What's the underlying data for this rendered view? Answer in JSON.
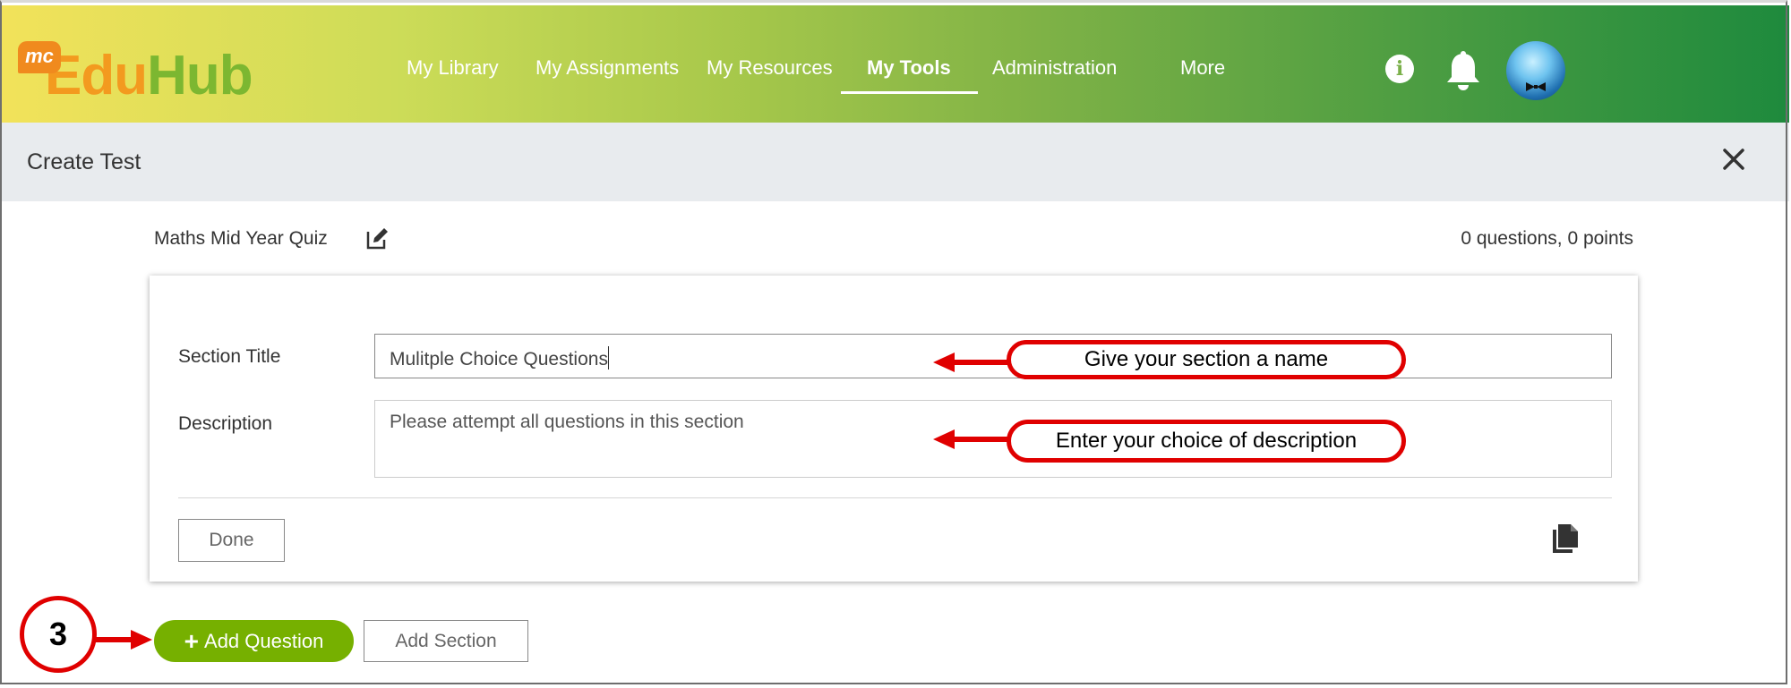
{
  "logo": {
    "badge": "mc",
    "part1": "Edu",
    "part2": "Hub"
  },
  "nav": {
    "items": [
      "My Library",
      "My Assignments",
      "My Resources",
      "My Tools",
      "Administration",
      "More"
    ],
    "active": "My Tools"
  },
  "header": {
    "title": "Create Test",
    "close_icon": "close-icon"
  },
  "test": {
    "name": "Maths Mid Year Quiz",
    "counts": "0 questions, 0 points"
  },
  "section": {
    "title_label": "Section Title",
    "title_value": "Mulitple Choice Questions",
    "description_label": "Description",
    "description_value": "Please attempt all questions in this section",
    "done_label": "Done"
  },
  "actions": {
    "add_question": "Add Question",
    "add_section": "Add Section"
  },
  "annotations": {
    "callout_title": "Give your section a name",
    "callout_description": "Enter your choice of description",
    "step_number": "3"
  },
  "colors": {
    "accent_green": "#76b000",
    "annotation_red": "#e00000",
    "header_gray": "#e8ebee"
  },
  "icons": [
    "info-icon",
    "bell-icon",
    "avatar",
    "close-icon",
    "edit-icon",
    "copy-icon",
    "plus-icon"
  ]
}
